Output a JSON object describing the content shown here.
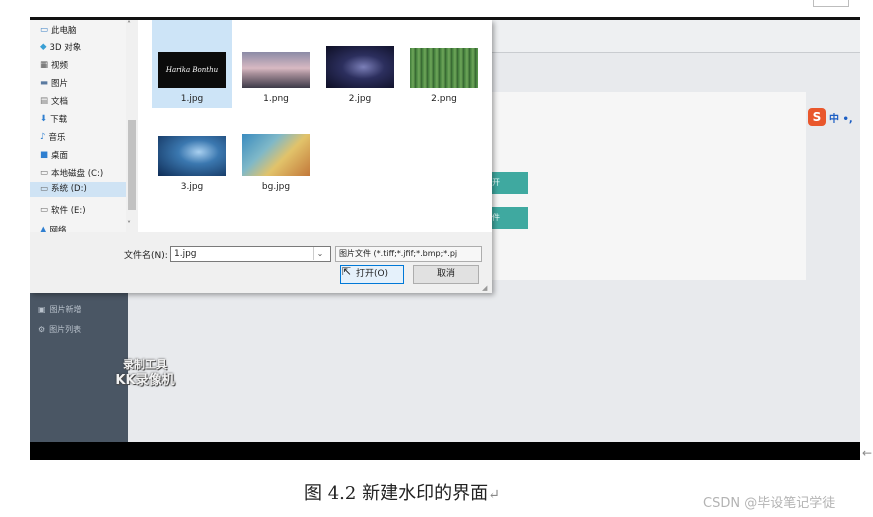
{
  "dialog": {
    "nav_items": [
      {
        "label": "此电脑",
        "icon": "computer-icon"
      },
      {
        "label": "3D 对象",
        "icon": "cube-icon"
      },
      {
        "label": "视频",
        "icon": "video-icon"
      },
      {
        "label": "图片",
        "icon": "picture-icon"
      },
      {
        "label": "文档",
        "icon": "document-icon"
      },
      {
        "label": "下载",
        "icon": "download-icon"
      },
      {
        "label": "音乐",
        "icon": "music-icon"
      },
      {
        "label": "桌面",
        "icon": "desktop-icon"
      },
      {
        "label": "本地磁盘 (C:)",
        "icon": "drive-icon"
      },
      {
        "label": "系统 (D:)",
        "icon": "drive-icon"
      },
      {
        "label": "软件 (E:)",
        "icon": "drive-icon"
      },
      {
        "label": "网络",
        "icon": "network-icon"
      }
    ],
    "selected_nav": "系统 (D:)",
    "files": [
      {
        "name": "1.jpg",
        "thumb_text": "Harika Bonthu"
      },
      {
        "name": "1.png"
      },
      {
        "name": "2.jpg"
      },
      {
        "name": "2.png"
      },
      {
        "name": "3.jpg"
      },
      {
        "name": "bg.jpg"
      }
    ],
    "selected_file": "1.jpg",
    "filename_label": "文件名(N):",
    "filename_value": "1.jpg",
    "filter_value": "图片文件 (*.tiff;*.jfif;*.bmp;*.pj",
    "open_label": "打开(O)",
    "cancel_label": "取消"
  },
  "app": {
    "sidebar_items": [
      "图片新增",
      "图片列表"
    ],
    "button_labels": [
      "开",
      "件"
    ],
    "watermark_line1": "录制工具",
    "watermark_line2": "KK录像机",
    "ime_label": "中 •,"
  },
  "caption": "图 4.2 新建水印的界面",
  "credit": "CSDN @毕设笔记学徒",
  "colors": {
    "teal": "#3fa9a0",
    "sidebar": "#4a5664",
    "selection": "#cde4f7",
    "open_border": "#0078d7"
  }
}
